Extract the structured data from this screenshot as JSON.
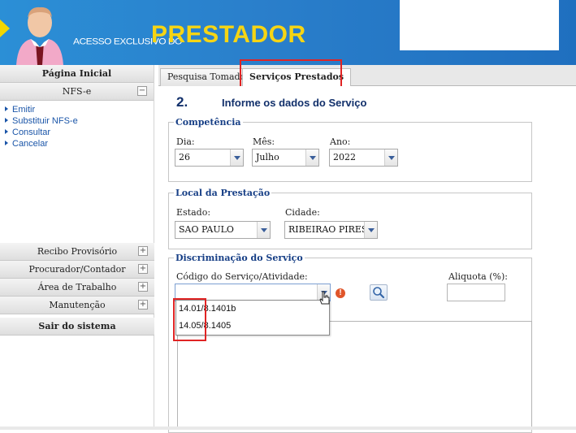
{
  "header": {
    "small_text": "ACESSO EXCLUSIVO DO",
    "big_text": "PRESTADOR"
  },
  "sidebar": {
    "home": "Página Inicial",
    "nfse_section": "NFS-e",
    "nfse_items": [
      {
        "label": "Emitir"
      },
      {
        "label": "Substituir NFS-e"
      },
      {
        "label": "Consultar"
      },
      {
        "label": "Cancelar"
      }
    ],
    "sections": [
      {
        "label": "Recibo Provisório"
      },
      {
        "label": "Procurador/Contador"
      },
      {
        "label": "Área de Trabalho"
      },
      {
        "label": "Manutenção"
      }
    ],
    "logout": "Sair do sistema",
    "minus": "−",
    "plus": "+"
  },
  "tabs": {
    "tab1": "Pesquisa Tomador",
    "tab2": "Serviços Prestados",
    "active": "Serviços Prestados"
  },
  "step": {
    "number": "2.",
    "title": "Informe os dados do Serviço"
  },
  "competencia": {
    "legend": "Competência",
    "dia_label": "Dia:",
    "dia_value": "26",
    "mes_label": "Mês:",
    "mes_value": "Julho",
    "ano_label": "Ano:",
    "ano_value": "2022"
  },
  "local": {
    "legend": "Local da Prestação",
    "estado_label": "Estado:",
    "estado_value": "SAO PAULO",
    "cidade_label": "Cidade:",
    "cidade_value": "RIBEIRAO PIRES"
  },
  "discriminacao": {
    "legend": "Discriminação do Serviço",
    "codigo_label": "Código do Serviço/Atividade:",
    "codigo_value": "",
    "aliquota_label": "Aliquota (%):",
    "aliquota_value": "",
    "options": [
      {
        "label": "14.01/8.1401b"
      },
      {
        "label": "14.05/8.1405"
      }
    ],
    "error_icon_glyph": "!"
  },
  "colors": {
    "banner_blue": "#2a7fcb",
    "banner_yellow": "#f6d514",
    "link_blue": "#1a55a8",
    "heading_navy": "#12306b",
    "highlight_red": "#e02424"
  }
}
